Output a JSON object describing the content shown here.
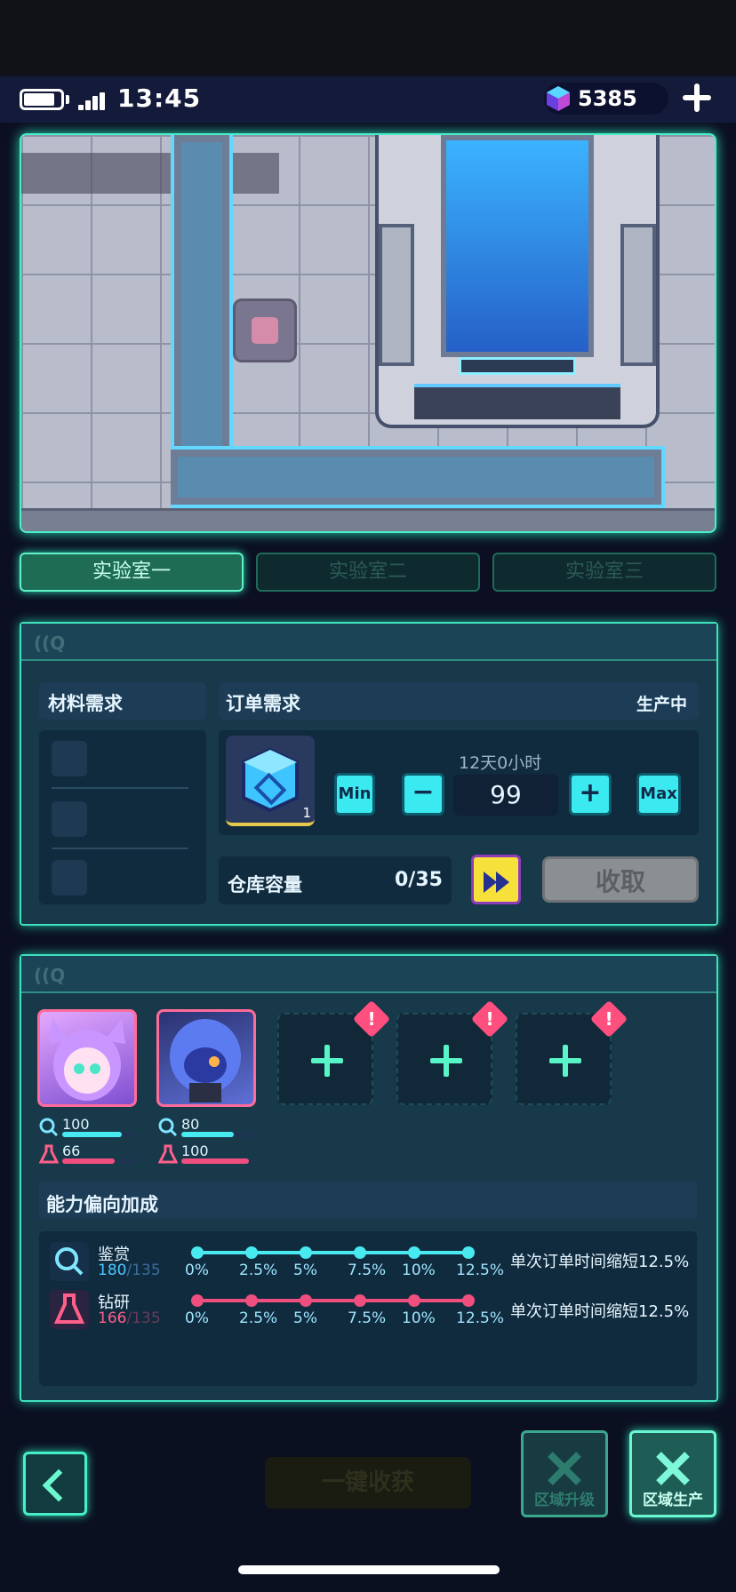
{
  "status": {
    "time": "13:45",
    "gems": "5385"
  },
  "tabs": [
    "实验室一",
    "实验室二",
    "实验室三"
  ],
  "order_panel": {
    "materials_title": "材料需求",
    "order_title": "订单需求",
    "status": "生产中",
    "item_count": "1",
    "duration": "12天0小时",
    "min_label": "Min",
    "max_label": "Max",
    "quantity": "99",
    "storage_label": "仓库容量",
    "storage_value": "0/35",
    "collect_label": "收取"
  },
  "crew_panel": {
    "members": [
      {
        "appraise": "100",
        "research": "66",
        "appraise_fill": 0.8,
        "research_fill": 0.7
      },
      {
        "appraise": "80",
        "research": "100",
        "appraise_fill": 0.7,
        "research_fill": 0.9
      }
    ],
    "empty_slots": 3,
    "alert_symbol": "!",
    "bonus_title": "能力偏向加成",
    "abilities": [
      {
        "name": "鉴赏",
        "current": "180",
        "max": "/135",
        "bonus": "单次订单时间缩短12.5%",
        "color": "#49e9f0"
      },
      {
        "name": "钻研",
        "current": "166",
        "max": "/135",
        "bonus": "单次订单时间缩短12.5%",
        "color": "#ee4f7f"
      }
    ],
    "ticks": [
      "0%",
      "2.5%",
      "5%",
      "7.5%",
      "10%",
      "12.5%"
    ]
  },
  "bottom": {
    "harvest_label": "一键收获",
    "upgrade_label": "区域升级",
    "produce_label": "区域生产"
  }
}
